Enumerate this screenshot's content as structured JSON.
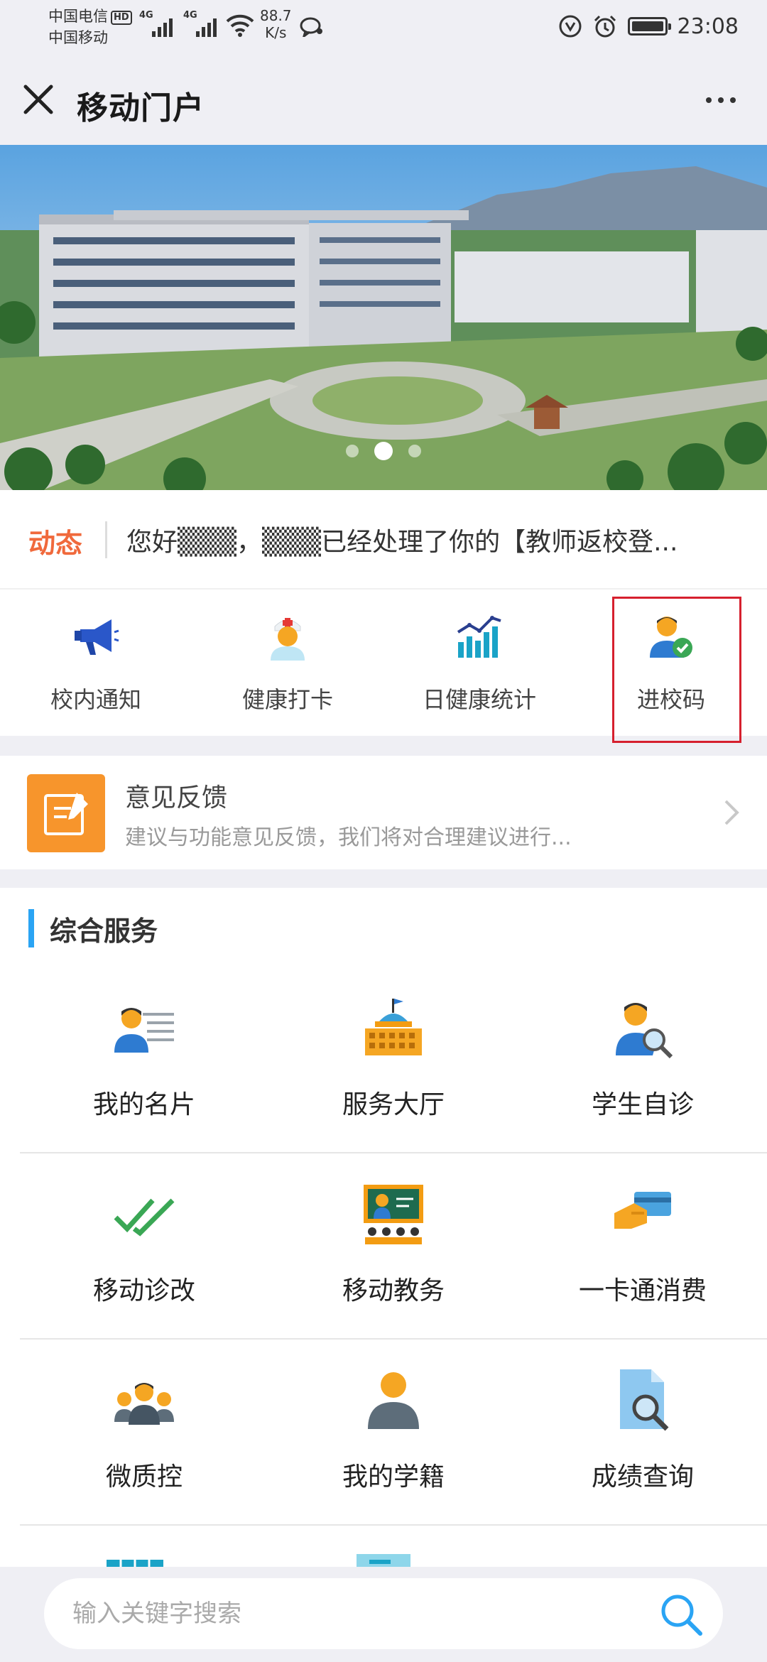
{
  "status_bar": {
    "carrier1": "中国电信",
    "carrier2": "中国移动",
    "hd": "HD",
    "net1": "4G",
    "net2": "4G",
    "speed_value": "88.7",
    "speed_unit": "K/s",
    "time": "23:08"
  },
  "header": {
    "title": "移动门户"
  },
  "banner": {
    "slide_count": 3,
    "active_index": 1
  },
  "ticker": {
    "tag": "动态",
    "text": "您好▒▒▒，▒▒▒已经处理了你的【教师返校登..."
  },
  "quick_actions": [
    {
      "label": "校内通知",
      "icon": "megaphone-icon"
    },
    {
      "label": "健康打卡",
      "icon": "nurse-icon"
    },
    {
      "label": "日健康统计",
      "icon": "bar-chart-icon"
    },
    {
      "label": "进校码",
      "icon": "user-check-icon"
    }
  ],
  "feedback": {
    "title": "意见反馈",
    "desc": "建议与功能意见反馈，我们将对合理建议进行..."
  },
  "services": {
    "heading": "综合服务",
    "items": [
      {
        "label": "我的名片",
        "icon": "business-card-icon"
      },
      {
        "label": "服务大厅",
        "icon": "hall-building-icon"
      },
      {
        "label": "学生自诊",
        "icon": "student-search-icon"
      },
      {
        "label": "移动诊改",
        "icon": "double-check-icon"
      },
      {
        "label": "移动教务",
        "icon": "teacher-board-icon"
      },
      {
        "label": "一卡通消费",
        "icon": "card-payment-icon"
      },
      {
        "label": "微质控",
        "icon": "group-icon"
      },
      {
        "label": "我的学籍",
        "icon": "person-icon"
      },
      {
        "label": "成绩查询",
        "icon": "document-search-icon"
      }
    ]
  },
  "search": {
    "placeholder": "输入关键字搜索"
  },
  "colors": {
    "accent_blue": "#2aa4f4",
    "ticker_orange": "#f0693c",
    "feedback_orange": "#f7952c",
    "highlight_red": "#d6202e"
  }
}
